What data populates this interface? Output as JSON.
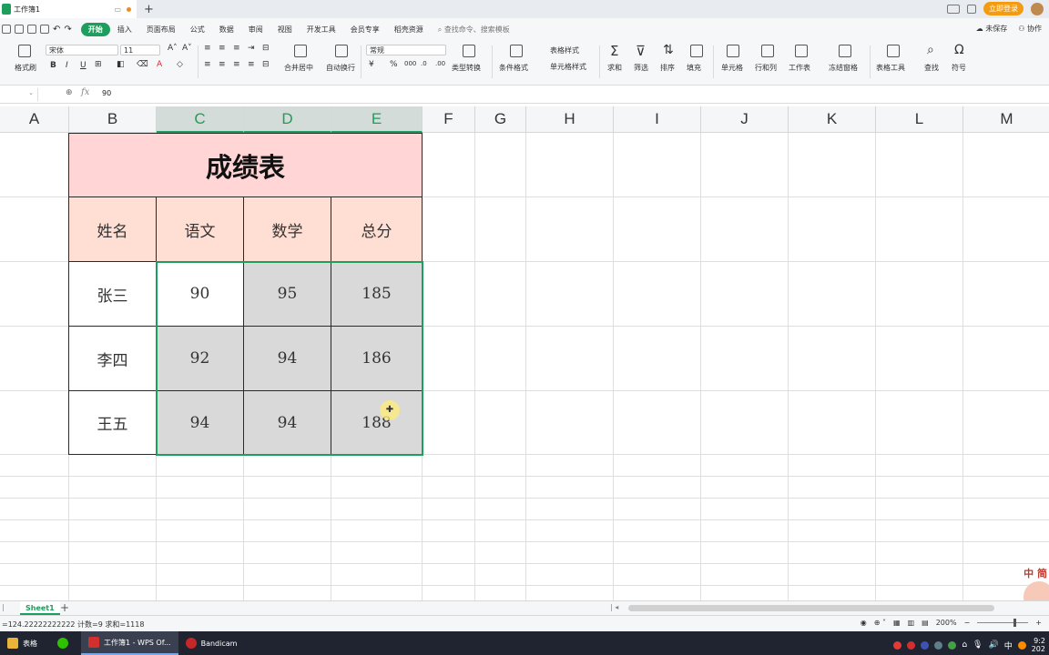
{
  "window": {
    "doc_tab": "工作簿1",
    "new_tab_symbol": "+",
    "login_label": "立即登录"
  },
  "menu": {
    "items": [
      "开始",
      "插入",
      "页面布局",
      "公式",
      "数据",
      "审阅",
      "视图",
      "开发工具",
      "会员专享",
      "稻壳资源"
    ],
    "active": "开始",
    "search_placeholder": "查找命令、搜索模板",
    "unsaved": "未保存",
    "collab": "协作"
  },
  "ribbon": {
    "format_painter": "格式刷",
    "font_name": "宋体",
    "font_size": "11",
    "merge_center": "合并居中",
    "wrap_text": "自动换行",
    "number_format": "常规",
    "type_convert": "类型转换",
    "conditional_format": "条件格式",
    "table_style": "表格样式",
    "cell_style": "单元格样式",
    "sum": "求和",
    "filter": "筛选",
    "sort": "排序",
    "fill": "填充",
    "cells": "单元格",
    "rows_cols": "行和列",
    "worksheet": "工作表",
    "freeze_panes": "冻结窗格",
    "table_tools": "表格工具",
    "find": "查找",
    "symbol": "符号",
    "bold": "B",
    "italic": "I",
    "underline": "U",
    "currency": "¥",
    "percent": "%"
  },
  "formula_bar": {
    "fx": "fx",
    "value": "90"
  },
  "columns": [
    "A",
    "B",
    "C",
    "D",
    "E",
    "F",
    "G",
    "H",
    "I",
    "J",
    "K",
    "L",
    "M"
  ],
  "selected_columns": [
    "C",
    "D",
    "E"
  ],
  "table": {
    "title": "成绩表",
    "headers": [
      "姓名",
      "语文",
      "数学",
      "总分"
    ],
    "rows": [
      [
        "张三",
        "90",
        "95",
        "185"
      ],
      [
        "李四",
        "92",
        "94",
        "186"
      ],
      [
        "王五",
        "94",
        "94",
        "188"
      ]
    ],
    "colors": {
      "title_bg": "#ffd5d5",
      "header_bg": "#ffdfd3",
      "selection": "#1e9e5c",
      "selected_fill": "#d9d9d9"
    }
  },
  "sheets": {
    "active": "Sheet1",
    "add": "+"
  },
  "status": {
    "summary": "=124.22222222222  计数=9  求和=1118",
    "zoom": "200%"
  },
  "taskbar": {
    "items": [
      "表格",
      "工作簿1 - WPS Of...",
      "Bandicam"
    ],
    "ime": "中"
  }
}
